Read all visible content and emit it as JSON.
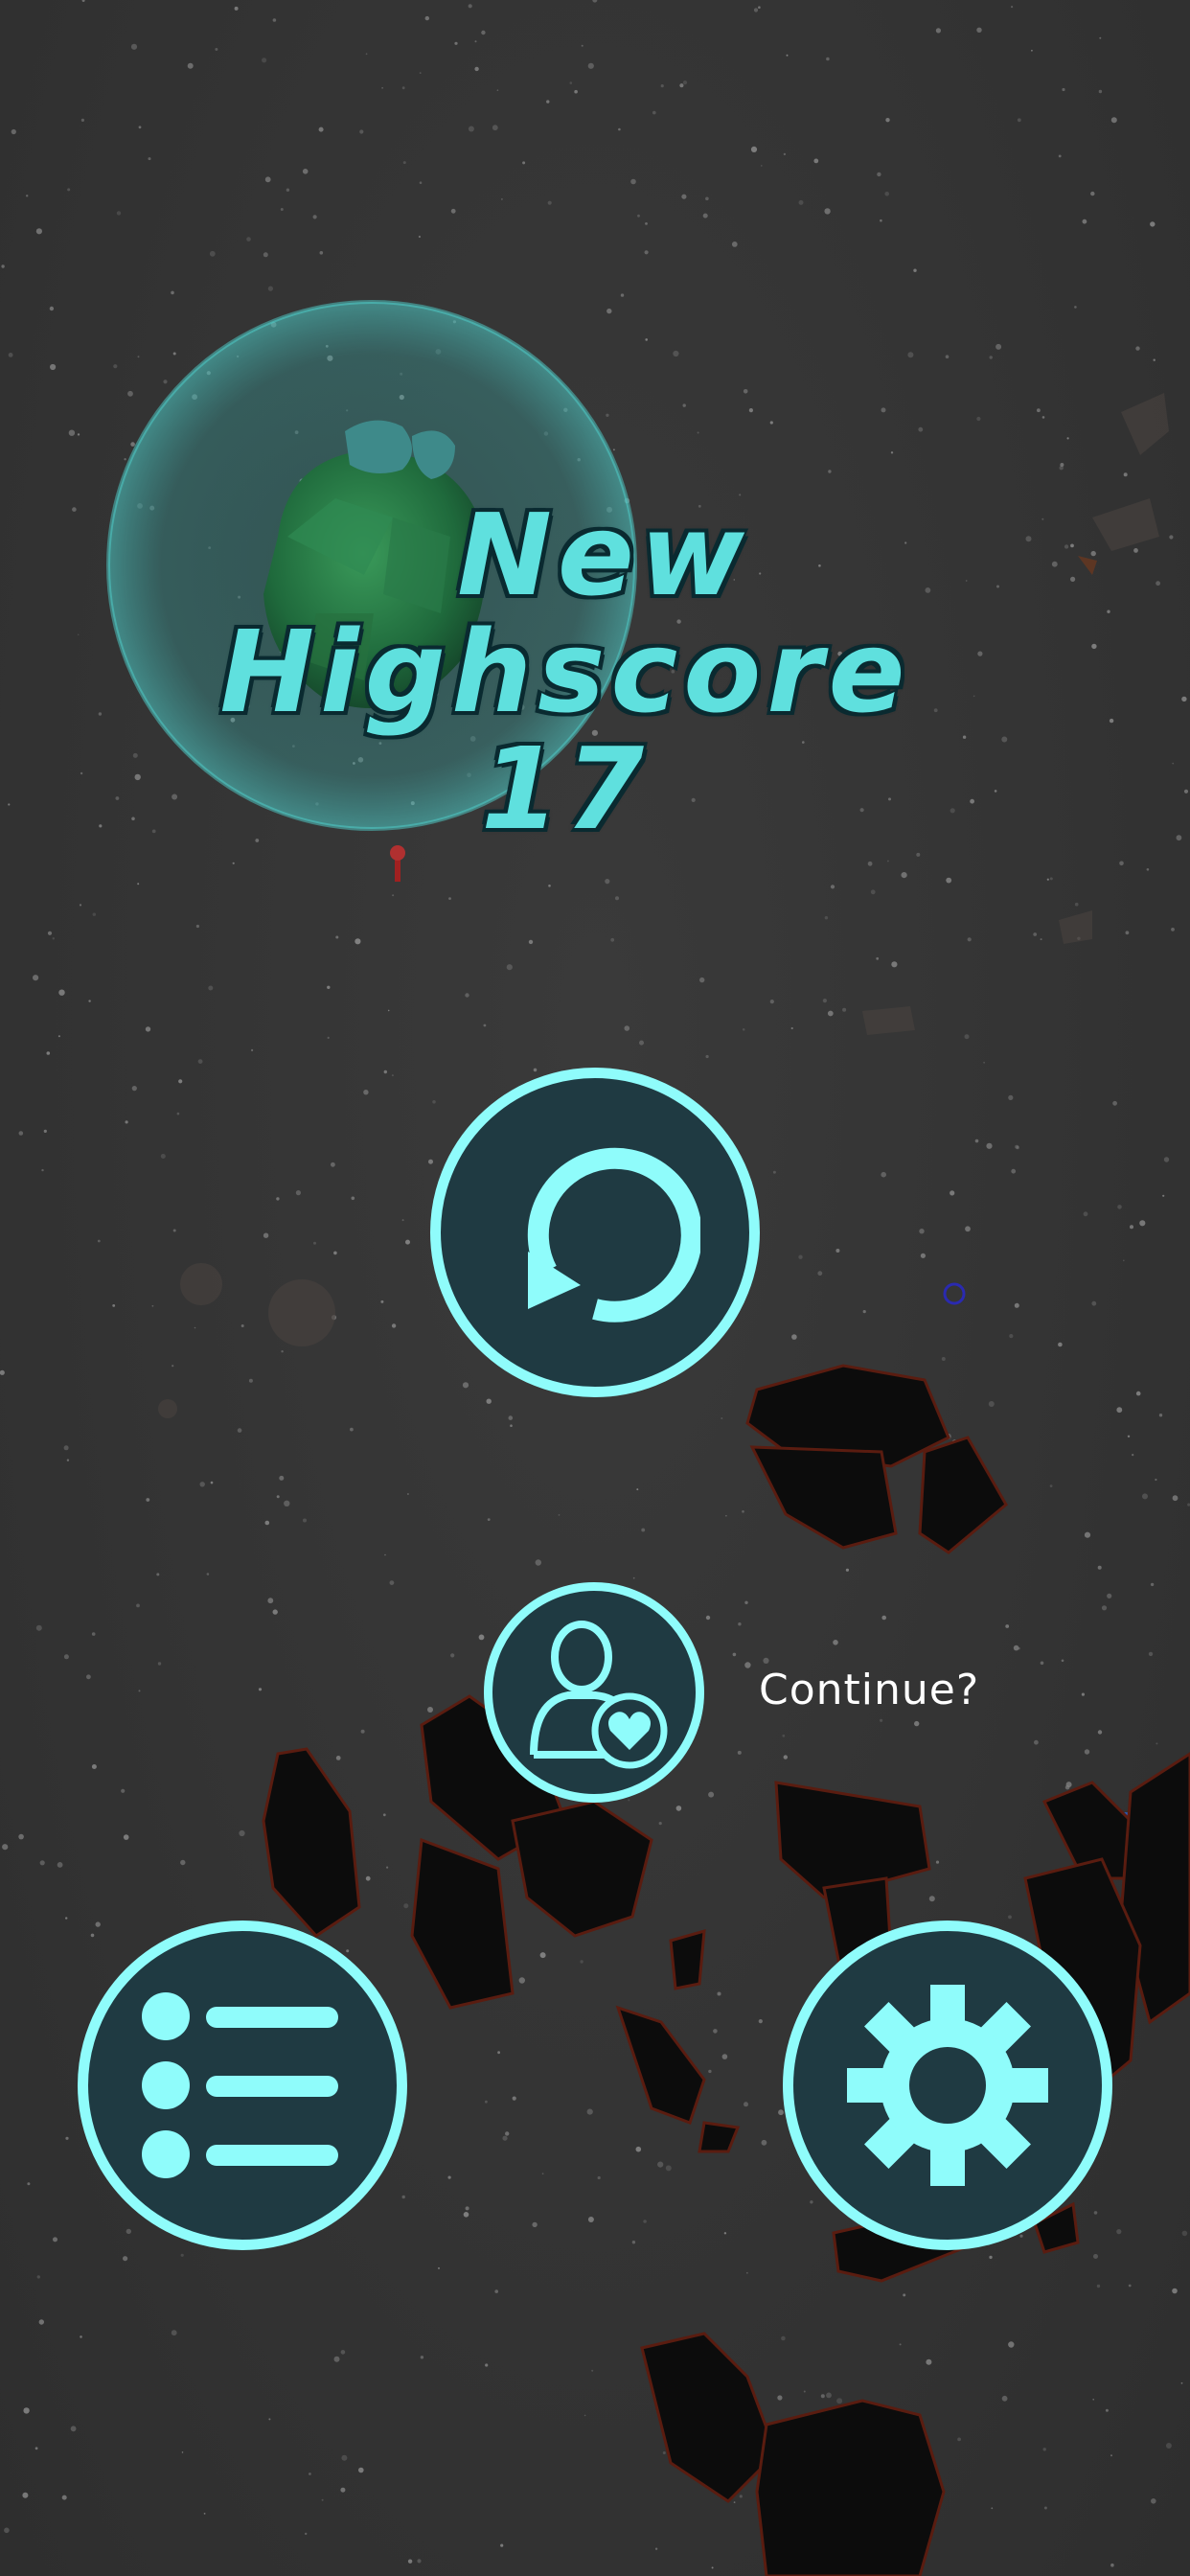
{
  "title": {
    "line1": "New",
    "line2": "Highscore",
    "score": "17"
  },
  "continue": {
    "label": "Continue?"
  },
  "buttons": {
    "restart_icon": "restart-icon",
    "continue_icon": "revive-user-heart-icon",
    "menu_icon": "list-menu-icon",
    "settings_icon": "gear-icon"
  },
  "colors": {
    "accent": "#8ffcfb",
    "button_fill": "#1f3a42",
    "title_fill": "#5fe0de",
    "title_outline": "#0a2a30",
    "background": "#353535"
  }
}
